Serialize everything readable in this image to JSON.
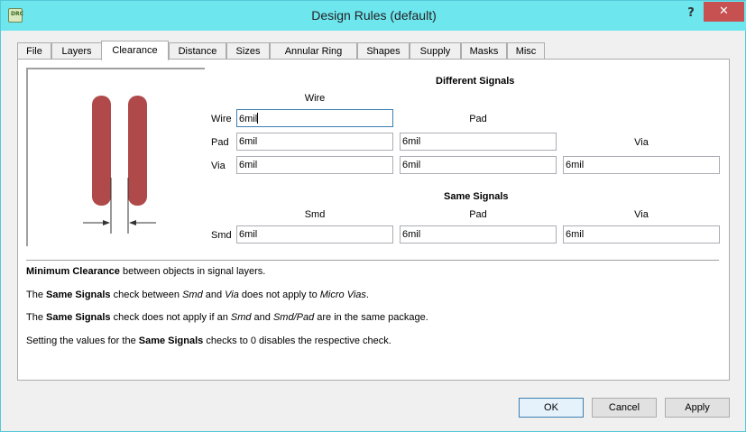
{
  "window": {
    "title": "Design Rules (default)",
    "icon_text": "DRC",
    "help_label": "?",
    "close_label": "✕"
  },
  "tabs": [
    {
      "label": "File"
    },
    {
      "label": "Layers"
    },
    {
      "label": "Clearance",
      "active": true
    },
    {
      "label": "Distance"
    },
    {
      "label": "Sizes"
    },
    {
      "label": "Annular Ring"
    },
    {
      "label": "Shapes"
    },
    {
      "label": "Supply"
    },
    {
      "label": "Masks"
    },
    {
      "label": "Misc"
    }
  ],
  "different_signals": {
    "heading": "Different Signals",
    "col_wire": "Wire",
    "col_pad": "Pad",
    "col_via": "Via",
    "row_wire": "Wire",
    "row_pad": "Pad",
    "row_via": "Via",
    "wire_wire": "6mil",
    "pad_wire": "6mil",
    "pad_pad": "6mil",
    "via_wire": "6mil",
    "via_pad": "6mil",
    "via_via": "6mil"
  },
  "same_signals": {
    "heading": "Same Signals",
    "col_smd": "Smd",
    "col_pad": "Pad",
    "col_via": "Via",
    "row_smd": "Smd",
    "smd_smd": "6mil",
    "smd_pad": "6mil",
    "smd_via": "6mil"
  },
  "notes": {
    "n1_b": "Minimum Clearance",
    "n1_t": " between objects in signal layers.",
    "n2_a": "The ",
    "n2_b": "Same Signals",
    "n2_c": " check between ",
    "n2_d": "Smd",
    "n2_e": " and ",
    "n2_f": "Via",
    "n2_g": " does not apply to ",
    "n2_h": "Micro Vias",
    "n2_i": ".",
    "n3_a": "The ",
    "n3_b": "Same Signals",
    "n3_c": " check does not apply if an ",
    "n3_d": "Smd",
    "n3_e": " and ",
    "n3_f": "Smd/Pad",
    "n3_g": " are in the same package.",
    "n4_a": "Setting the values for the ",
    "n4_b": "Same Signals",
    "n4_c": " checks to 0 disables the respective check."
  },
  "buttons": {
    "ok": "OK",
    "cancel": "Cancel",
    "apply": "Apply"
  },
  "colors": {
    "titlebar": "#6ee6ee",
    "trace": "#b04a4a",
    "close": "#c75050"
  }
}
